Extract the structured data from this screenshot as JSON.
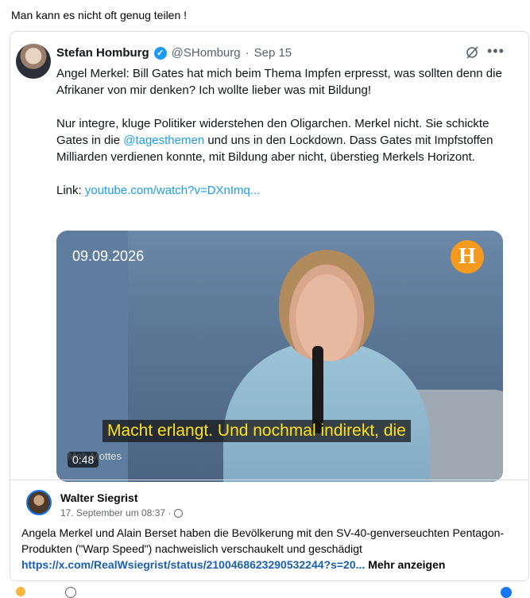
{
  "post": {
    "text": "Man kann es nicht oft genug teilen !"
  },
  "tweet": {
    "name": "Stefan Homburg",
    "verified_icon": "verified-badge-icon",
    "handle": "@SHomburg",
    "separator": "·",
    "date": "Sep 15",
    "paragraph1": "Angel Merkel: Bill Gates hat mich beim Thema Impfen erpresst, was sollten denn die Afrikaner von mir denken? Ich wollte lieber was mit Bildung!",
    "paragraph2_before": "Nur integre, kluge Politiker widerstehen den Oligarchen. Merkel nicht. Sie schickte Gates in die ",
    "mention": "@tagesthemen",
    "paragraph2_after": " und uns in den Lockdown. Dass Gates mit Impfstoffen Milliarden verdienen konnte, mit Bildung aber nicht, überstieg Merkels Horizont.",
    "link_label": "Link: ",
    "link_url": "youtube.com/watch?v=DXnImq...",
    "video": {
      "date": "09.09.2026",
      "logo_letter": "H",
      "subtitle": "Macht erlangt. Und nochmal indirekt, die",
      "watermark": "Meh Mottes",
      "duration": "0:48"
    }
  },
  "shared": {
    "name": "Walter Siegrist",
    "meta": "17. September um 08:37 ·",
    "text": "Angela Merkel und Alain Berset haben die Bevölkerung mit den SV-40-genverseuchten Pentagon-Produkten (\"Warp Speed\") nachweislich verschaukelt und geschädigt",
    "link": "https://x.com/RealWsiegrist/status/2100468623290532244?s=20...",
    "more": " Mehr anzeigen"
  },
  "colors": {
    "link": "#1d9bf0",
    "fb_link": "#1a5fb4",
    "accent": "#1877f2",
    "subtitle": "#ffe11a",
    "logo": "#f39a1f"
  }
}
